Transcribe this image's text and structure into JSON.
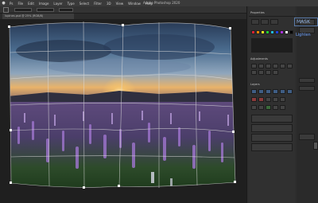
{
  "window": {
    "title": "Adobe Photoshop 2020"
  },
  "menu": {
    "items": [
      "Ps",
      "File",
      "Edit",
      "Image",
      "Layer",
      "Type",
      "Select",
      "Filter",
      "3D",
      "View",
      "Window",
      "Help"
    ]
  },
  "document": {
    "tab_label": "lupines.psd @ 25% (RGB/8)"
  },
  "panels": {
    "right_title_1": "Properties",
    "right_title_2": "Adjustments",
    "right_title_3": "Layers",
    "ghost_label": "MASK",
    "blue_link": "Lighten"
  },
  "colors": {
    "sky_top": "#2b3d5a",
    "sky_mid": "#5b7ca0",
    "sunset": "#f2b15a",
    "field": "#6a4a8a",
    "grass": "#2e5a2a",
    "grid": "#dcdcdc",
    "panel": "#303030",
    "accent": "#3f5d84"
  }
}
